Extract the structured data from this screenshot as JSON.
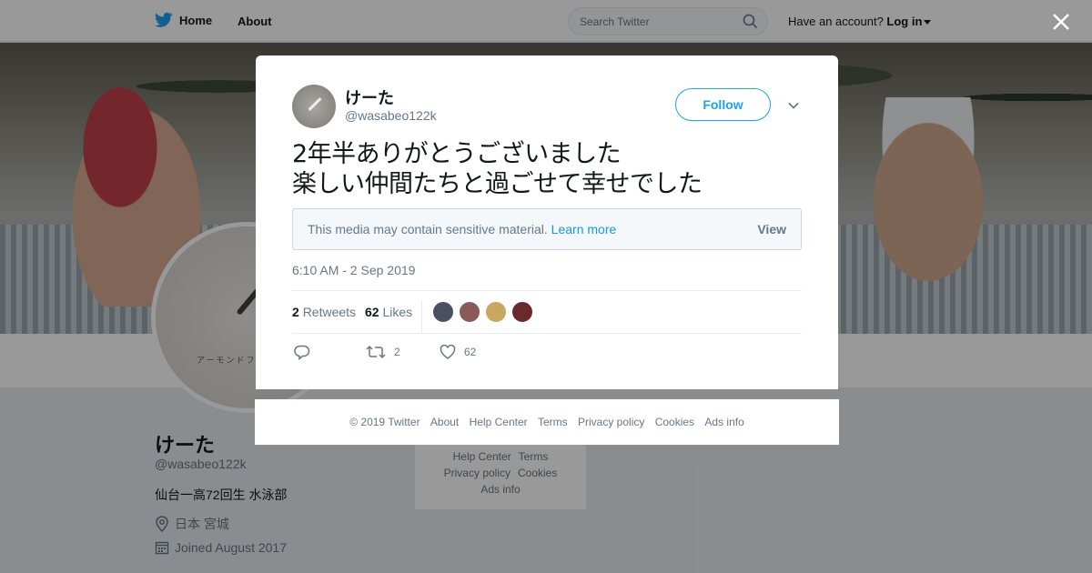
{
  "nav": {
    "home_label": "Home",
    "about_label": "About"
  },
  "search": {
    "placeholder": "Search Twitter"
  },
  "account": {
    "prompt": "Have an account?",
    "login_label": "Log in"
  },
  "profile": {
    "name": "けーた",
    "handle": "@wasabeo122k",
    "bio": "仙台一高72回生 水泳部",
    "location": "日本 宮城",
    "joined": "Joined August 2017",
    "avatar_caption": "アーモンドフィッシュ"
  },
  "side_links": {
    "help_center": "Help Center",
    "terms": "Terms",
    "privacy": "Privacy policy",
    "cookies": "Cookies",
    "ads_info": "Ads info"
  },
  "tweet": {
    "author_name": "けーた",
    "author_handle": "@wasabeo122k",
    "follow_label": "Follow",
    "text": "2年半ありがとうございました\n楽しい仲間たちと過ごせて幸せでした",
    "sensitive_notice": "This media may contain sensitive material.",
    "learn_more": "Learn more",
    "view_label": "View",
    "timestamp": "6:10 AM - 2 Sep 2019",
    "retweets_count": "2",
    "retweets_label": "Retweets",
    "likes_count": "62",
    "likes_label": "Likes",
    "action_retweets": "2",
    "action_likes": "62",
    "liker_colors": [
      "#4a5060",
      "#8a5a5a",
      "#c8a860",
      "#6a2a2a"
    ]
  },
  "footer": {
    "copyright": "© 2019 Twitter",
    "about": "About",
    "help_center": "Help Center",
    "terms": "Terms",
    "privacy": "Privacy policy",
    "cookies": "Cookies",
    "ads_info": "Ads info"
  },
  "colors": {
    "accent": "#1da1f2",
    "link": "#1b95e0",
    "muted": "#657786"
  }
}
